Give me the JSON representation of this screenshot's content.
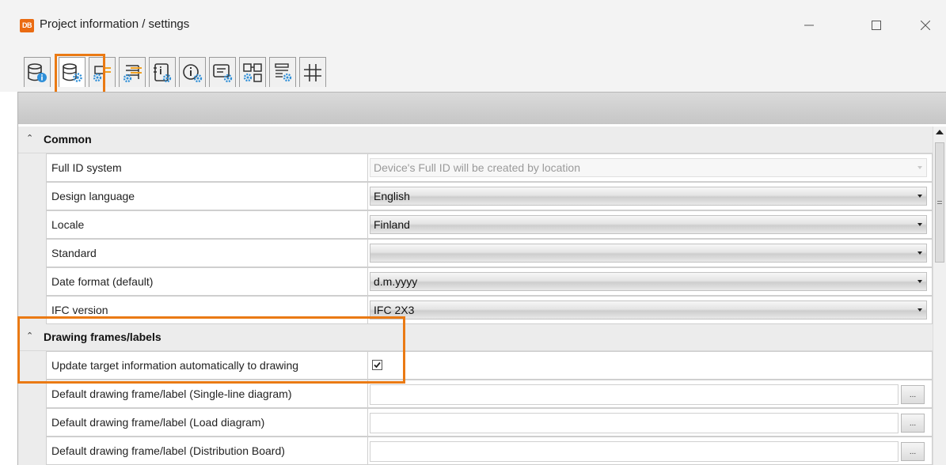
{
  "window": {
    "title": "Project information / settings",
    "app_logo": "DB",
    "controls": [
      "minimize-icon",
      "maximize-icon",
      "close-icon"
    ]
  },
  "tabs": [
    {
      "icon": "database-info-icon",
      "selected": false
    },
    {
      "icon": "database-settings-icon",
      "selected": true
    },
    {
      "icon": "connector-settings-icon",
      "selected": false
    },
    {
      "icon": "hierarchy-settings-icon",
      "selected": false
    },
    {
      "icon": "notebook-settings-icon",
      "selected": false
    },
    {
      "icon": "info-settings-icon",
      "selected": false
    },
    {
      "icon": "message-settings-icon",
      "selected": false
    },
    {
      "icon": "structure-settings-icon",
      "selected": false
    },
    {
      "icon": "numbered-list-settings-icon",
      "selected": false
    },
    {
      "icon": "hash-icon",
      "selected": false
    }
  ],
  "groups": {
    "common": {
      "label": "Common",
      "properties": [
        {
          "name": "Full ID system",
          "value": "Device's Full ID will be created by location",
          "enabled": false
        },
        {
          "name": "Design language",
          "value": "English",
          "enabled": true
        },
        {
          "name": "Locale",
          "value": "Finland",
          "enabled": true
        },
        {
          "name": "Standard",
          "value": "",
          "enabled": true
        },
        {
          "name": "Date format (default)",
          "value": "d.m.yyyy",
          "enabled": true
        },
        {
          "name": "IFC version",
          "value": "IFC 2X3",
          "enabled": true
        }
      ]
    },
    "drawing": {
      "label": "Drawing frames/labels",
      "properties": [
        {
          "name": "Update target information automatically to drawing",
          "checked": true
        },
        {
          "name": "Default drawing frame/label (Single-line diagram)",
          "value": "",
          "button": "..."
        },
        {
          "name": "Default drawing frame/label (Load diagram)",
          "value": "",
          "button": "..."
        },
        {
          "name": "Default drawing frame/label (Distribution Board)",
          "value": "",
          "button": "..."
        }
      ]
    }
  },
  "colors": {
    "accent_highlight": "#ea7a14",
    "tab_icon_blue": "#2f8fd8",
    "tab_icon_orange": "#f0a020"
  }
}
